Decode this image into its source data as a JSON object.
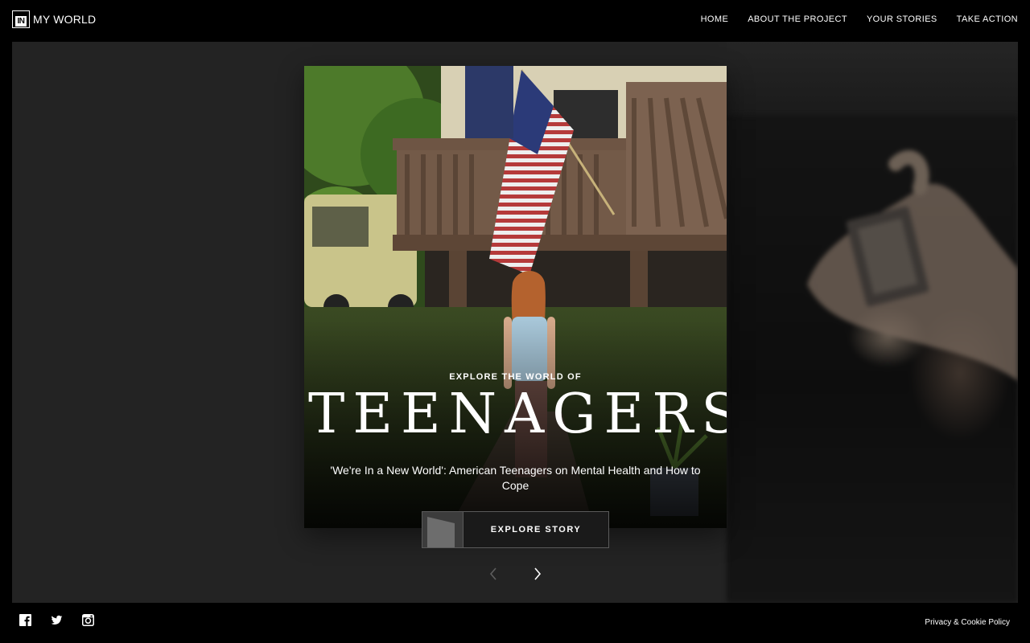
{
  "header": {
    "logo_mark": "IN",
    "logo_text": "MY WORLD",
    "nav": [
      {
        "label": "HOME"
      },
      {
        "label": "ABOUT THE PROJECT"
      },
      {
        "label": "YOUR STORIES"
      },
      {
        "label": "TAKE ACTION"
      }
    ]
  },
  "slide": {
    "eyebrow": "EXPLORE THE WORLD OF",
    "title": "TEENAGERS",
    "subtitle": "'We're In a New World': American Teenagers on Mental Health and How to Cope",
    "button_label": "EXPLORE STORY"
  },
  "carousel": {
    "prev_icon": "chevron-left-icon",
    "next_icon": "chevron-right-icon",
    "prev_enabled": false
  },
  "footer": {
    "socials": [
      "facebook-icon",
      "twitter-icon",
      "instagram-icon"
    ],
    "privacy_label": "Privacy & Cookie Policy"
  },
  "colors": {
    "page_bg": "#000000",
    "stage_bg": "#232323",
    "text": "#ffffff"
  }
}
